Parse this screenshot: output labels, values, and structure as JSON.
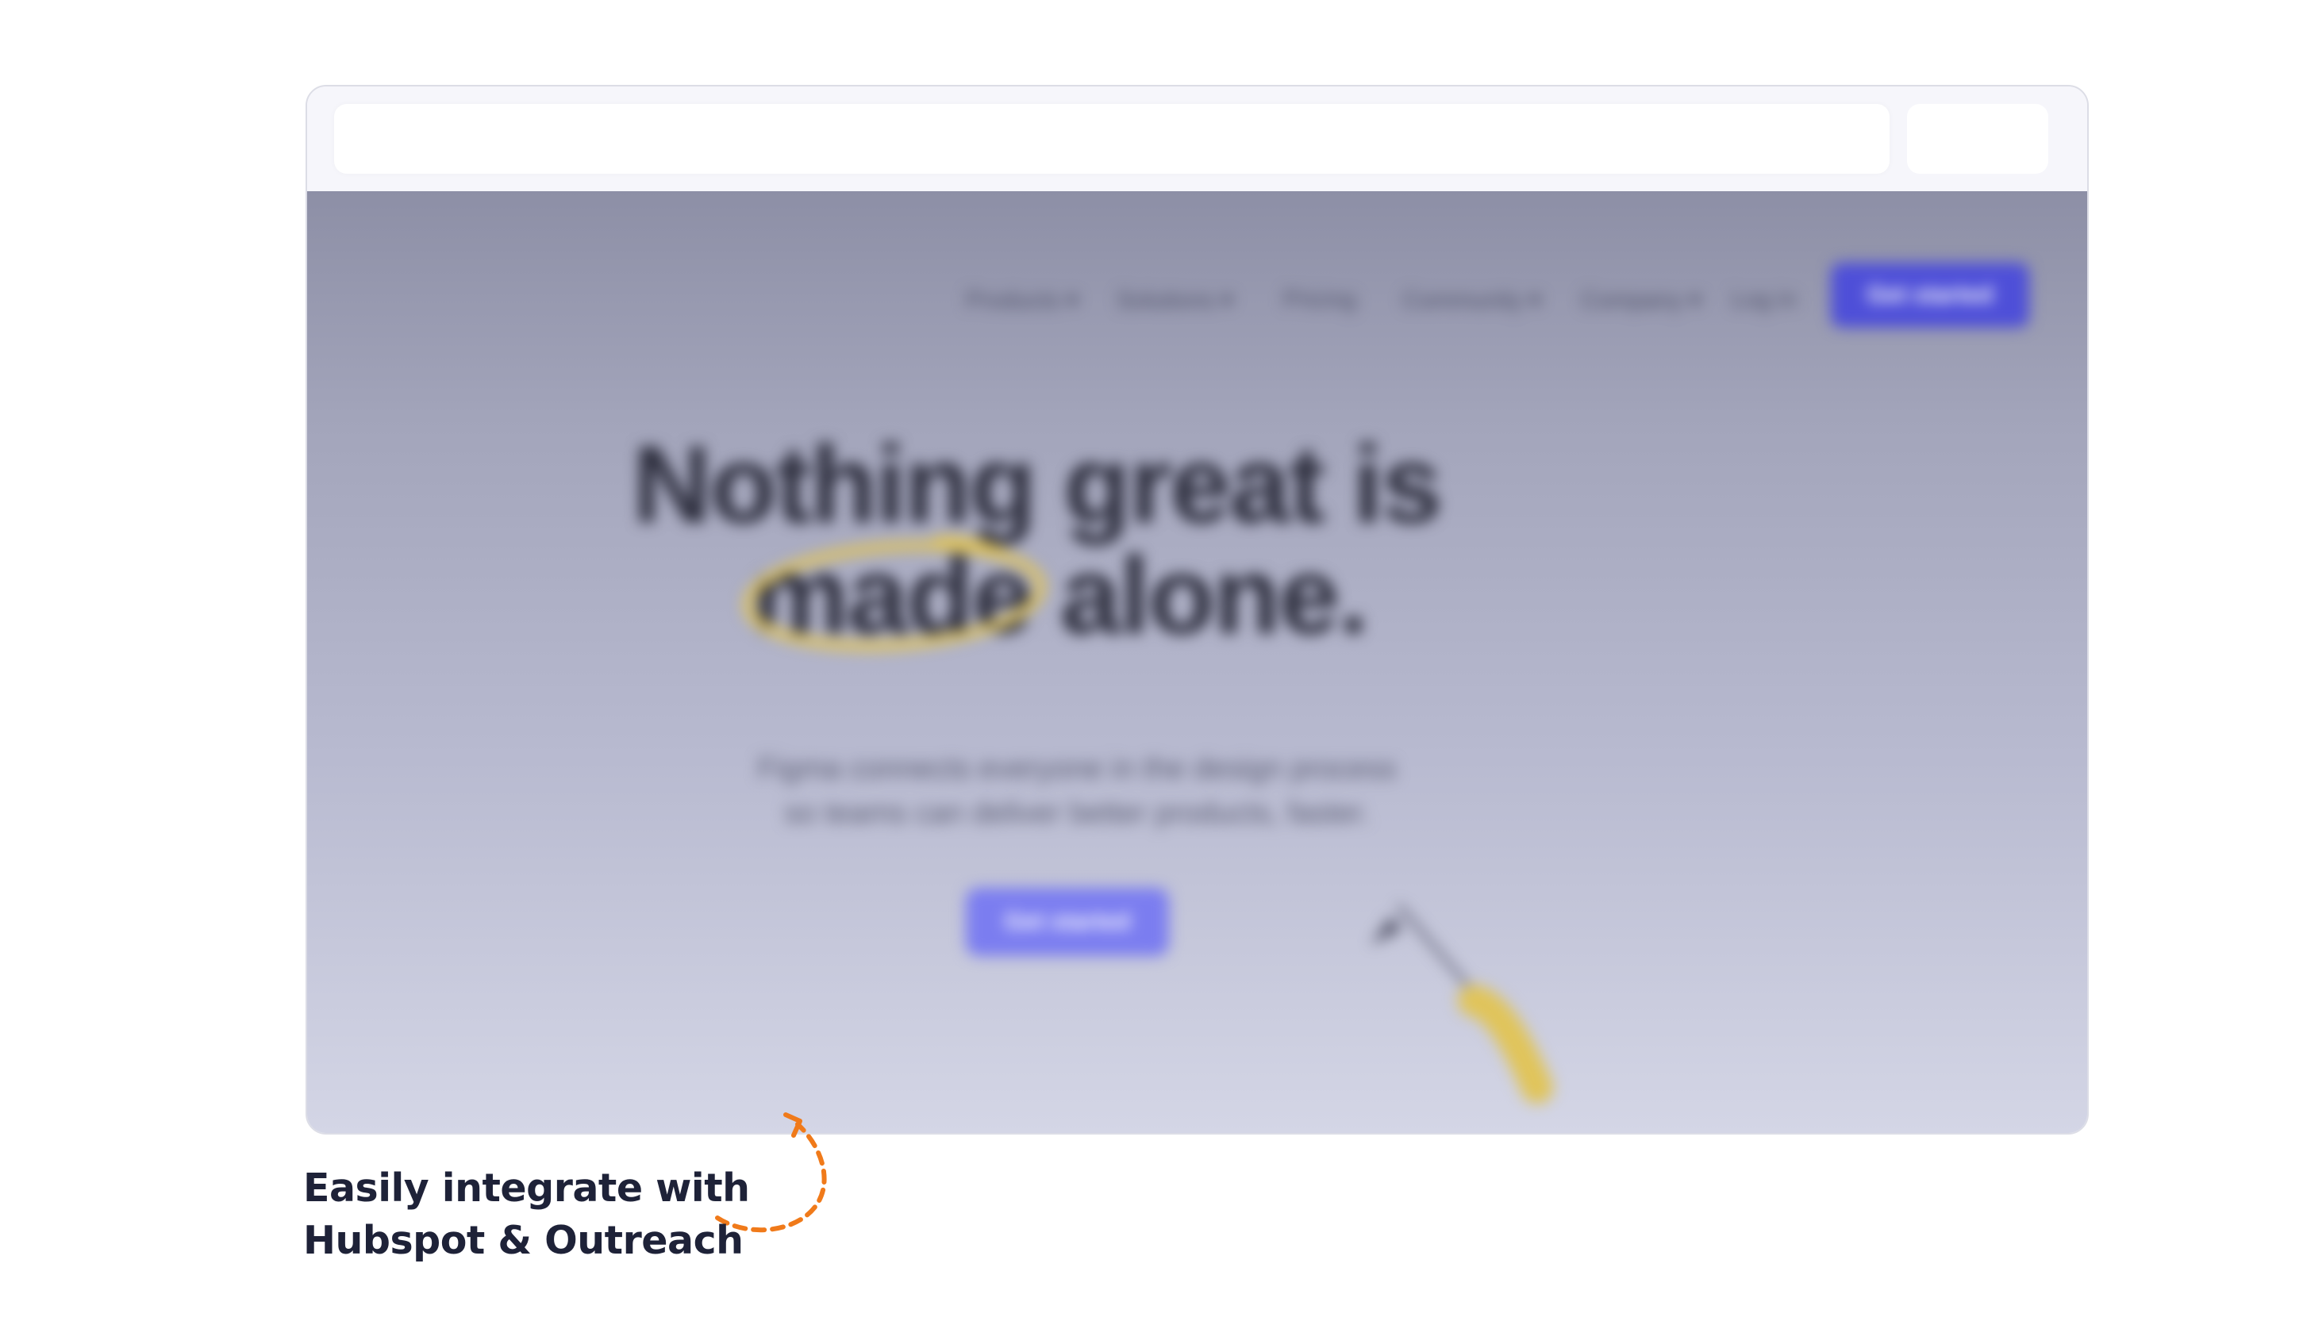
{
  "browser": {
    "address_bar_value": "",
    "chrome_button_label": ""
  },
  "site": {
    "nav": {
      "items": [
        "Products ▾",
        "Solutions ▾",
        "Pricing",
        "Community ▾",
        "Company ▾",
        "Log in"
      ],
      "cta_label": "Get started"
    },
    "hero": {
      "title_line1": "Nothing great is",
      "title_line2": "made alone.",
      "subtitle_line1": "Figma connects everyone in the design process",
      "subtitle_line2": "so teams can deliver better products, faster.",
      "cta_label": "Get started"
    }
  },
  "caption": {
    "line1": "Easily integrate with",
    "line2": "Hubspot & Outreach"
  },
  "colors": {
    "accent": "#4e4fd8",
    "annotation_arrow": "#f07a1a",
    "caption_text": "#1e2238",
    "highlight": "#e0c45a"
  },
  "icons": {
    "arrow": "curved-dashed-arrow-icon",
    "pencil": "pencil-icon"
  }
}
